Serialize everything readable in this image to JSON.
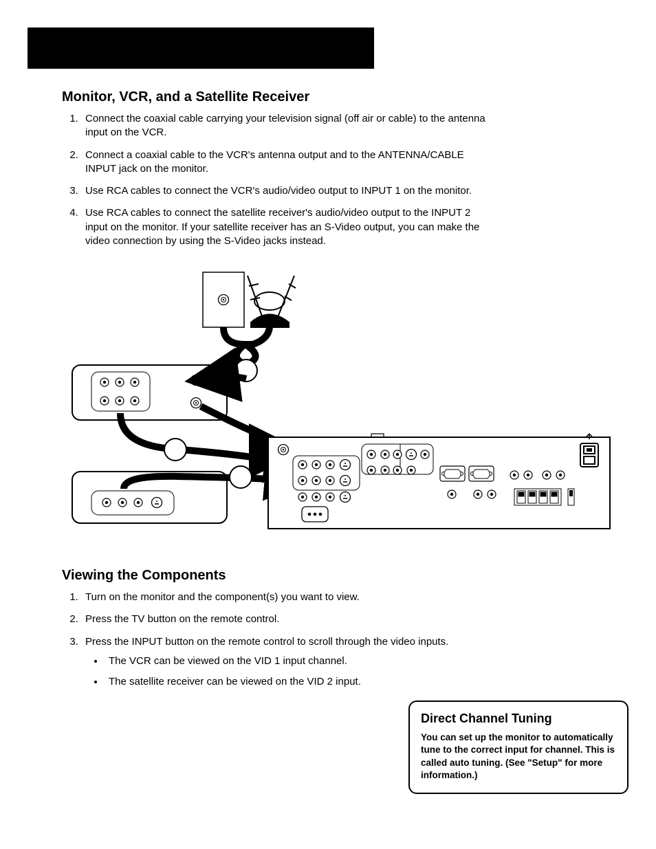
{
  "section1": {
    "title": "Monitor, VCR, and a Satellite Receiver",
    "steps": [
      "Connect the coaxial cable carrying your television signal (off air or cable) to the antenna input on the VCR.",
      "Connect a coaxial cable to the VCR's antenna output and to the ANTENNA/CABLE INPUT jack on the monitor.",
      "Use RCA cables to connect the VCR's audio/video output to INPUT 1 on the monitor.",
      "Use RCA cables to connect the satellite receiver's audio/video output to the INPUT 2 input on the monitor. If your satellite receiver has an S-Video output, you can make the video connection by using the S-Video jacks instead."
    ]
  },
  "section2": {
    "title": "Viewing the Components",
    "steps": [
      "Turn on the monitor and the component(s) you want to view.",
      "Press the TV button on the remote control.",
      "Press the INPUT button on the remote control to scroll through the video inputs."
    ],
    "sub": [
      "The VCR can be viewed on the VID 1 input channel.",
      "The satellite receiver can be viewed on the VID 2 input."
    ]
  },
  "callout": {
    "title": "Direct Channel Tuning",
    "body": "You can set up the monitor to automatically tune to the correct input for channel. This is called auto tuning. (See \"Setup\" for more information.)"
  }
}
